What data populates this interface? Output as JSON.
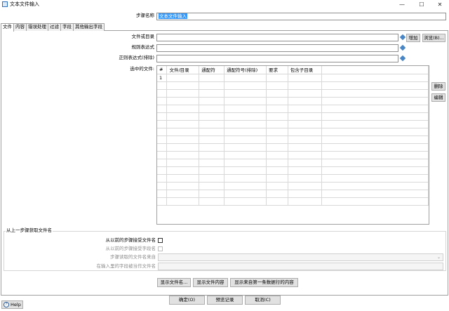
{
  "window": {
    "title": "文本文件输入",
    "minimize": "—",
    "maximize": "☐",
    "close": "✕"
  },
  "step_name": {
    "label": "步骤名称",
    "value": "文本文件输入"
  },
  "tabs": [
    {
      "label": "文件"
    },
    {
      "label": "内容"
    },
    {
      "label": "错误处理"
    },
    {
      "label": "过滤"
    },
    {
      "label": "字段"
    },
    {
      "label": "其他输出字段"
    }
  ],
  "file_tab": {
    "file_or_dir_label": "文件或目录",
    "file_or_dir_value": "",
    "regex_label": "规则表达式",
    "regex_value": "",
    "regex_exclude_label": "正则表达式(排除)",
    "regex_exclude_value": "",
    "add_button": "增加",
    "browse_button": "浏览(B)...",
    "selected_files_label": "选中的文件:",
    "delete_button": "删除",
    "edit_button": "编辑",
    "grid": {
      "columns": [
        "#",
        "文件/目录",
        "通配符",
        "通配符号(排除)",
        "要求",
        "包含子目录"
      ],
      "rows": [
        [
          "1",
          "",
          "",
          "",
          "",
          ""
        ]
      ]
    }
  },
  "prev_step": {
    "group_title": "从上一步骤获取文件名",
    "accept_label": "从以前的步骤接受文件名",
    "accept_step_label": "从以前的步骤接受字段名",
    "step_source_label": "步骤读取的文件名来自",
    "field_label": "在输入里的字段被当作文件名"
  },
  "bottom_buttons": {
    "show_filenames": "显示文件名...",
    "show_content": "显示文件内容",
    "show_first_row": "显示来自第一条数据行的内容"
  },
  "footer": {
    "ok": "确定(O)",
    "preview": "预览记录",
    "cancel": "取消(C)",
    "help": "Help",
    "help_icon": "?"
  }
}
